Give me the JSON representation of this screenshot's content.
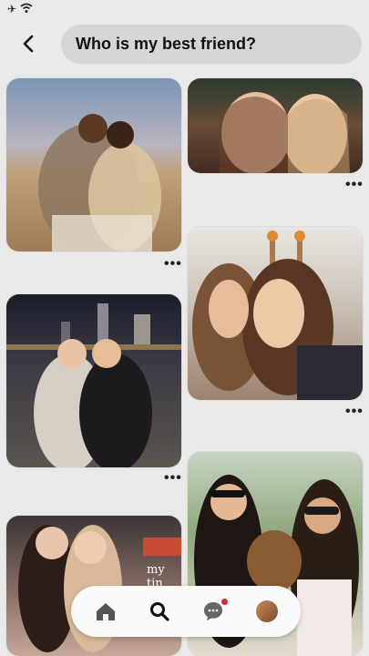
{
  "status_bar": {
    "airplane": "✈",
    "wifi": "wifi-icon"
  },
  "search": {
    "query": "Who is my best friend?"
  },
  "pins": [
    {
      "name": "pin-1"
    },
    {
      "name": "pin-2"
    },
    {
      "name": "pin-3"
    },
    {
      "name": "pin-4"
    },
    {
      "name": "pin-5"
    },
    {
      "name": "pin-6",
      "caption": "my tin"
    }
  ],
  "more_label": "•••",
  "nav": {
    "items": [
      "home-icon",
      "search-icon",
      "chat-icon",
      "profile-avatar"
    ],
    "chat_badge_color": "#e0233a"
  }
}
